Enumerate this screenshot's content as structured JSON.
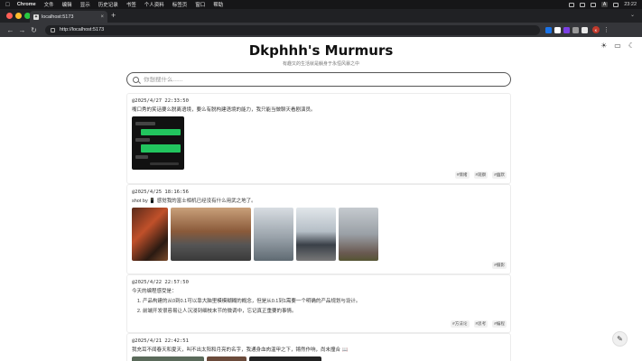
{
  "menubar": {
    "app": "Chrome",
    "items": [
      "文件",
      "编辑",
      "显示",
      "历史记录",
      "书签",
      "个人资料",
      "标签页",
      "窗口",
      "帮助"
    ],
    "clock": "23:22"
  },
  "tab": {
    "title": "localhost:5173"
  },
  "toolbar": {
    "url": "http://localhost:5173"
  },
  "site": {
    "title": "Dkphhh's Murmurs",
    "subtitle": "有趣又的生活就是躺身于永恒风暴之中",
    "search_placeholder": "你想搜什么......"
  },
  "posts": [
    {
      "date": "@2025/4/27 22:33:50",
      "text": "嘴口秀的笑话要么脱离语境，要么有脱构建语境的能力，我只能当做聊天看剧演员。",
      "tags": [
        "#情绪",
        "#观察",
        "#幽默"
      ]
    },
    {
      "date": "@2025/4/25 18:16:56",
      "text": "shot by 📱 感觉我的富士相机已经没有什么用武之地了。",
      "tags": [
        "#摄影"
      ]
    },
    {
      "date": "@2025/4/22 22:57:50",
      "text": "今天的编程感受是：",
      "list": [
        "产品构建的从0到0.1可以靠大脑里模模糊糊的概念，但是从0.1到1需要一个明确的产品规划与设计。",
        "前端开发很容易让人沉浸到细枝末节的微调中，忘记真正重要的事情。"
      ],
      "tags": [
        "#方法论",
        "#思考",
        "#编程"
      ]
    },
    {
      "date": "@2025/4/21 22:42:51",
      "text": "我充耳不闻春天和夏天，叫不出太阳和月亮的名字，我通身血肉温甲之下，锵然作响，尚未撞合 📖"
    }
  ],
  "colors": {
    "accent": "#22c55e",
    "page_bg": "#ffffff",
    "chrome_dark": "#202124"
  }
}
